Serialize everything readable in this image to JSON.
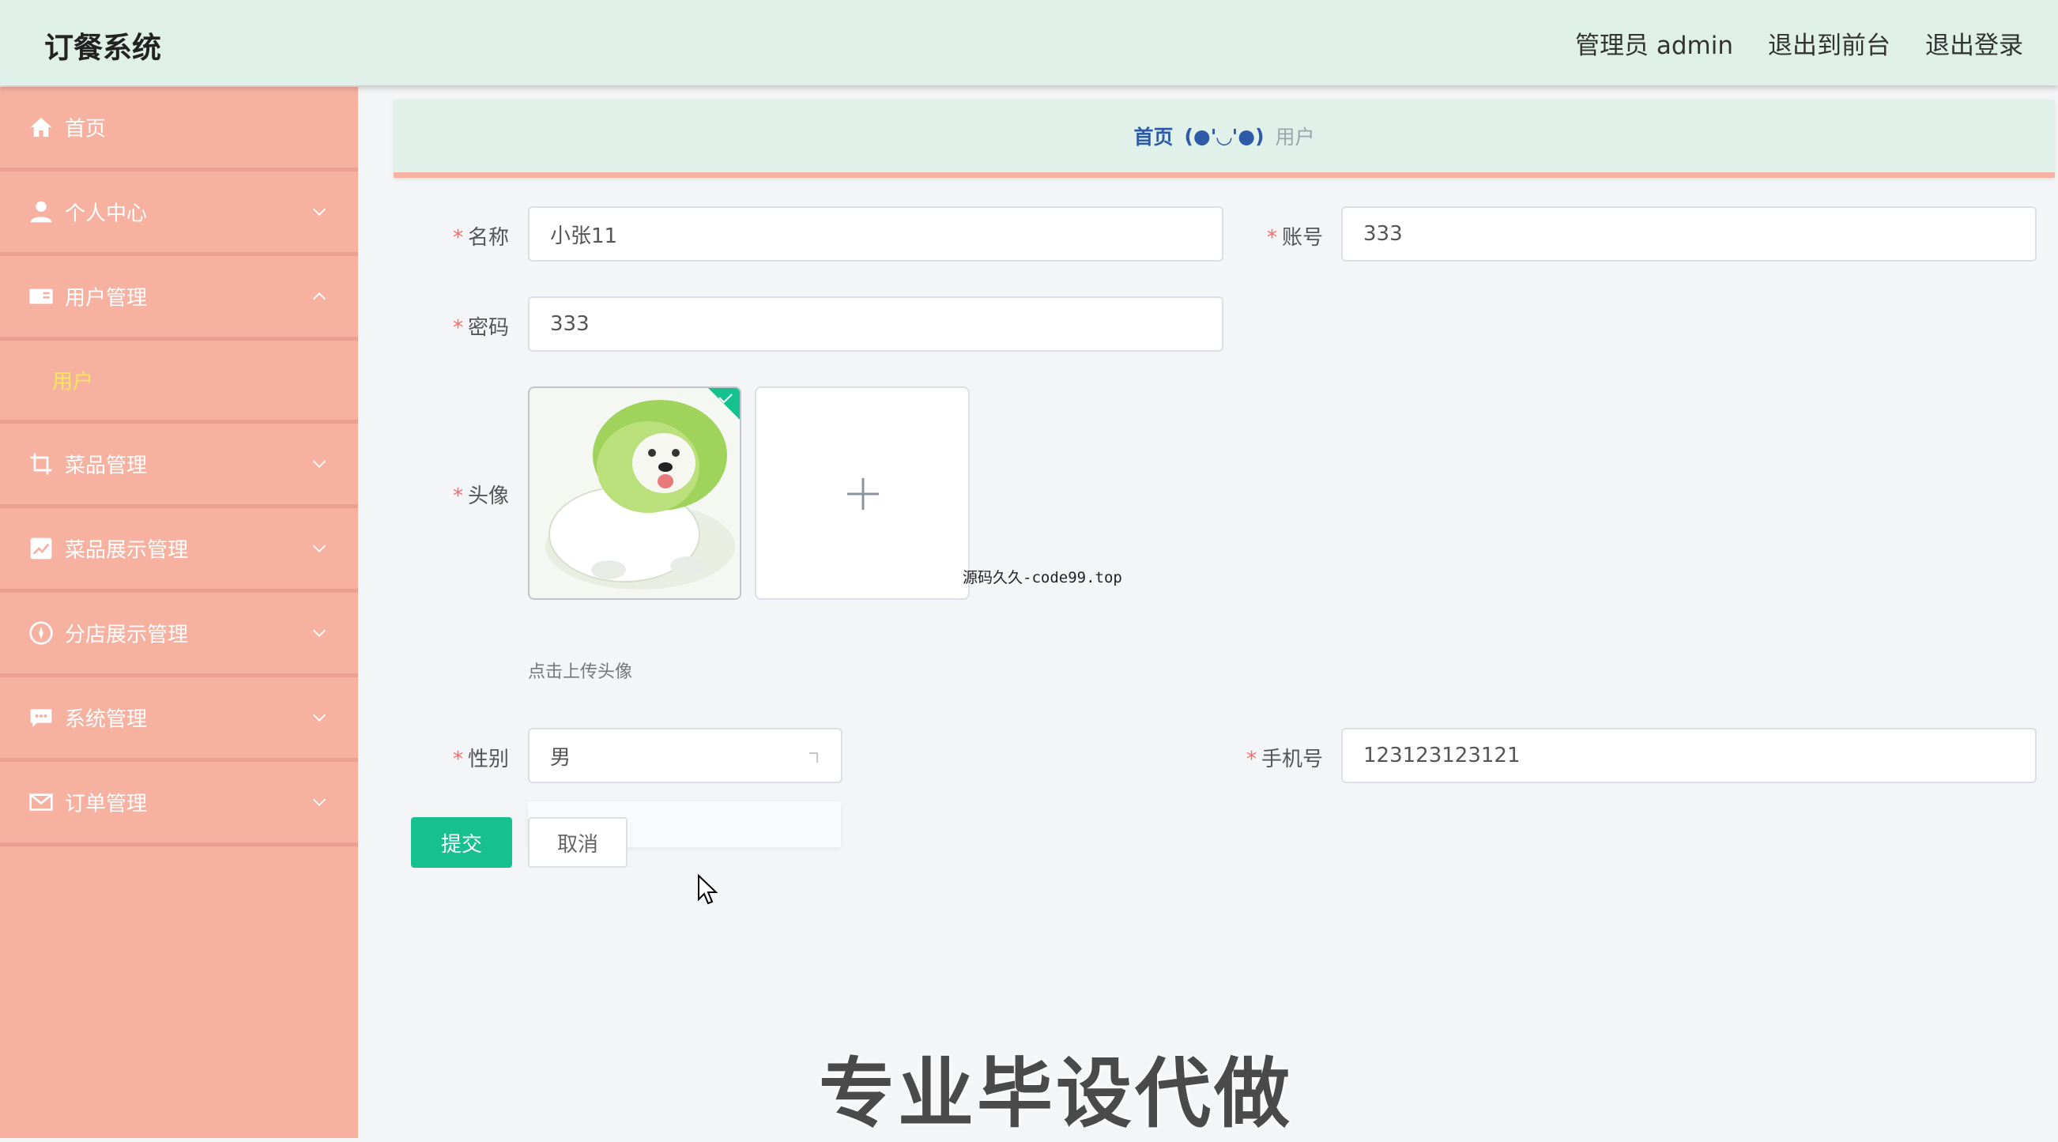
{
  "header": {
    "title": "订餐系统",
    "admin": "管理员 admin",
    "to_front": "退出到前台",
    "logout": "退出登录"
  },
  "sidebar": {
    "items": [
      {
        "label": "首页",
        "icon": "home-icon"
      },
      {
        "label": "个人中心",
        "icon": "user-icon"
      },
      {
        "label": "用户管理",
        "icon": "id-card-icon",
        "expanded": true,
        "sub": [
          "用户"
        ]
      },
      {
        "label": "菜品管理",
        "icon": "crop-icon"
      },
      {
        "label": "菜品展示管理",
        "icon": "chart-icon"
      },
      {
        "label": "分店展示管理",
        "icon": "compass-icon"
      },
      {
        "label": "系统管理",
        "icon": "chat-icon"
      },
      {
        "label": "订单管理",
        "icon": "mail-icon"
      }
    ],
    "sub_user": "用户"
  },
  "breadcrumb": {
    "home": "首页",
    "separator": "(●'◡'●)",
    "current": "用户"
  },
  "form": {
    "name_label": "名称",
    "name_value": "小张11",
    "account_label": "账号",
    "account_value": "333",
    "password_label": "密码",
    "password_value": "333",
    "avatar_label": "头像",
    "avatar_hint": "点击上传头像",
    "gender_label": "性别",
    "gender_value": "男",
    "phone_label": "手机号",
    "phone_value": "123123123121",
    "submit": "提交",
    "cancel": "取消"
  },
  "watermarks": {
    "small": "源码久久-code99.top",
    "big": "专业毕设代做"
  },
  "colors": {
    "sidebar": "#f6b1a1",
    "header": "#dff0e8",
    "accent": "#17c08f",
    "submenu_active": "#f7e760"
  }
}
